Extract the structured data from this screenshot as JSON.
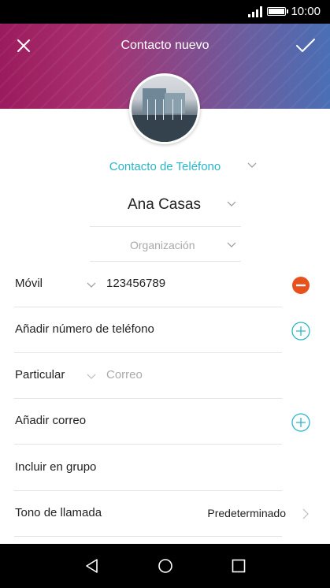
{
  "status_bar": {
    "time": "10:00",
    "icons": [
      "signal-icon",
      "battery-icon"
    ]
  },
  "header": {
    "title": "Contacto nuevo",
    "close_icon": "close-icon",
    "confirm_icon": "check-icon"
  },
  "account": {
    "label": "Contacto de Teléfono"
  },
  "name": {
    "value": "Ana Casas"
  },
  "organization": {
    "placeholder": "Organización"
  },
  "phone": {
    "type": "Móvil",
    "value": "123456789",
    "remove_icon": "remove-circle-icon"
  },
  "add_phone": {
    "label": "Añadir número de teléfono",
    "icon": "add-circle-icon"
  },
  "email": {
    "type": "Particular",
    "placeholder": "Correo"
  },
  "add_email": {
    "label": "Añadir correo",
    "icon": "add-circle-icon"
  },
  "group": {
    "label": "Incluir en grupo"
  },
  "ringtone": {
    "label": "Tono de llamada",
    "value": "Predeterminado"
  },
  "nav_bar": {
    "icons": [
      "back-icon",
      "home-icon",
      "recents-icon"
    ]
  },
  "colors": {
    "accent": "#2ab5c8",
    "remove": "#e8501c",
    "header_start": "#9b1c5e",
    "header_end": "#4a6fb5"
  }
}
